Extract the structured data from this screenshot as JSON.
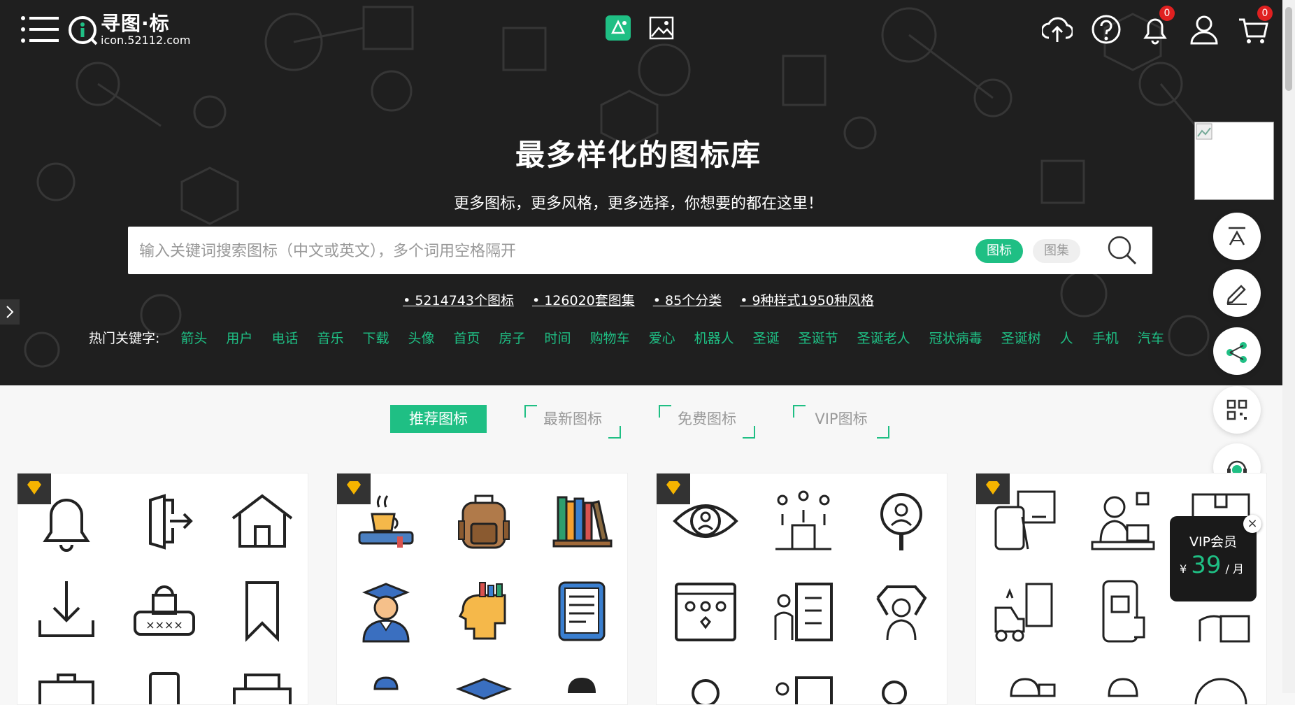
{
  "logo": {
    "title": "寻图·标",
    "sub": "icon.52112.com"
  },
  "badges": {
    "notifications": "0",
    "cart": "0"
  },
  "hero": {
    "headline": "最多样化的图标库",
    "subline": "更多图标，更多风格，更多选择，你想要的都在这里！"
  },
  "search": {
    "placeholder": "输入关键词搜索图标（中文或英文），多个词用空格隔开",
    "toggle_icon": "图标",
    "toggle_set": "图集"
  },
  "stats": [
    "5214743个图标",
    "126020套图集",
    "85个分类",
    "9种样式1950种风格"
  ],
  "hot": {
    "label": "热门关键字:",
    "items": [
      "箭头",
      "用户",
      "电话",
      "音乐",
      "下载",
      "头像",
      "首页",
      "房子",
      "时间",
      "购物车",
      "爱心",
      "机器人",
      "圣诞",
      "圣诞节",
      "圣诞老人",
      "冠状病毒",
      "圣诞树",
      "人",
      "手机",
      "汽车"
    ]
  },
  "tabs": [
    "推荐图标",
    "最新图标",
    "免费图标",
    "VIP图标"
  ],
  "vip_popup": {
    "title": "VIP会员",
    "currency": "¥",
    "price": "39",
    "unit": "/ 月",
    "close": "×"
  },
  "colors": {
    "accent": "#1fbf84",
    "hero_bg": "#1f1f1f",
    "badge": "#e02020",
    "vip_gold": "#f5b400"
  }
}
